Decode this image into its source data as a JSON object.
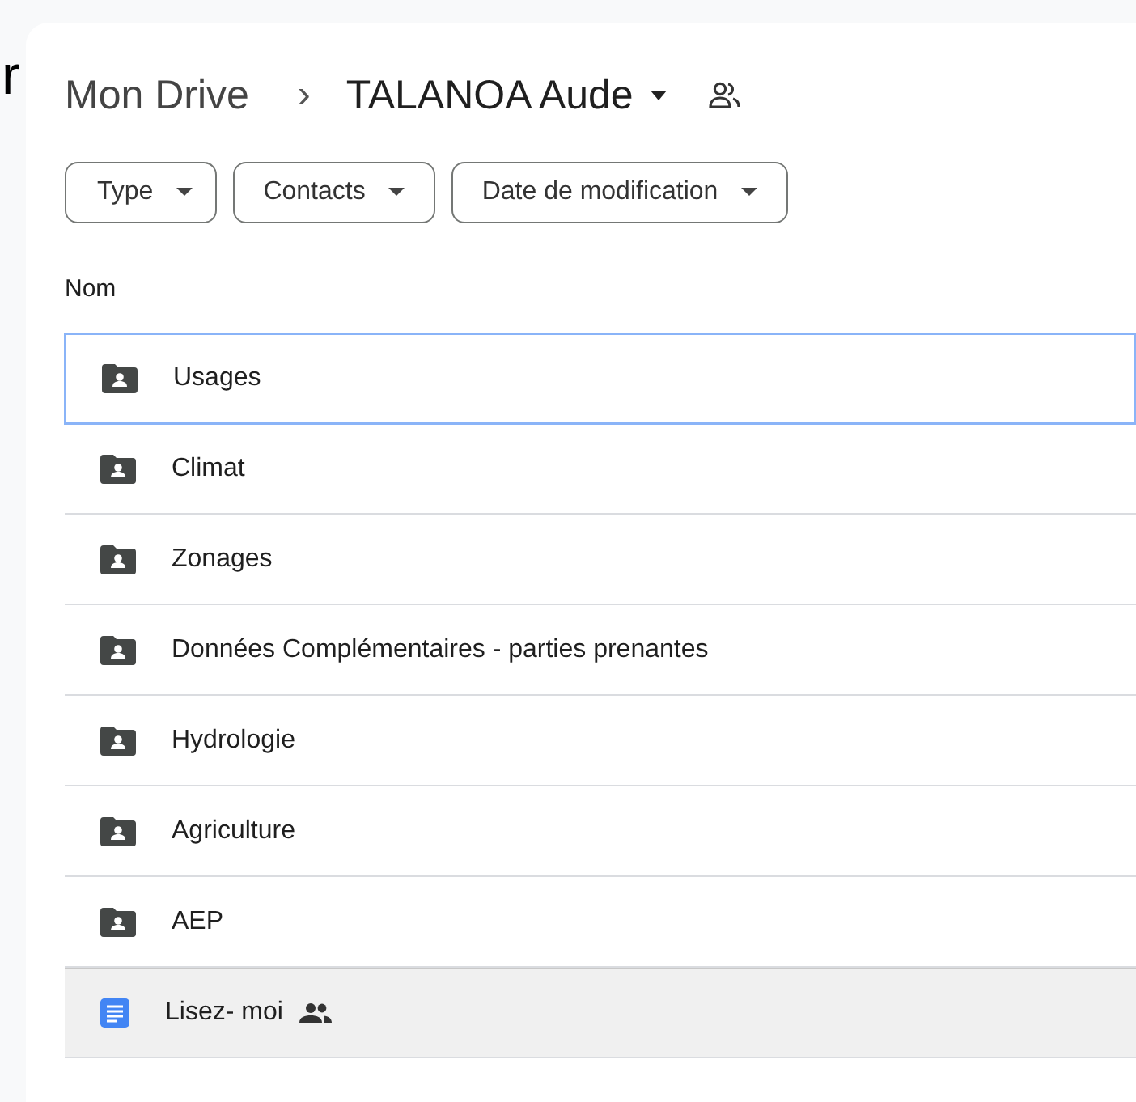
{
  "cut_text": "r",
  "breadcrumb": {
    "root": "Mon Drive",
    "separator": "›",
    "current": "TALANOA Aude",
    "shared": true
  },
  "filters": [
    {
      "label": "Type"
    },
    {
      "label": "Contacts"
    },
    {
      "label": "Date de modification"
    }
  ],
  "column_header": "Nom",
  "files": [
    {
      "name": "Usages",
      "kind": "folder",
      "selected": true,
      "hovered": false,
      "shared": false
    },
    {
      "name": "Climat",
      "kind": "folder",
      "selected": false,
      "hovered": false,
      "shared": false
    },
    {
      "name": "Zonages",
      "kind": "folder",
      "selected": false,
      "hovered": false,
      "shared": false
    },
    {
      "name": "Données Complémentaires - parties prenantes",
      "kind": "folder",
      "selected": false,
      "hovered": false,
      "shared": false
    },
    {
      "name": "Hydrologie",
      "kind": "folder",
      "selected": false,
      "hovered": false,
      "shared": false
    },
    {
      "name": "Agriculture",
      "kind": "folder",
      "selected": false,
      "hovered": false,
      "shared": false
    },
    {
      "name": "AEP",
      "kind": "folder",
      "selected": false,
      "hovered": false,
      "shared": false
    },
    {
      "name": "Lisez- moi",
      "kind": "document",
      "selected": false,
      "hovered": true,
      "shared": true
    }
  ]
}
